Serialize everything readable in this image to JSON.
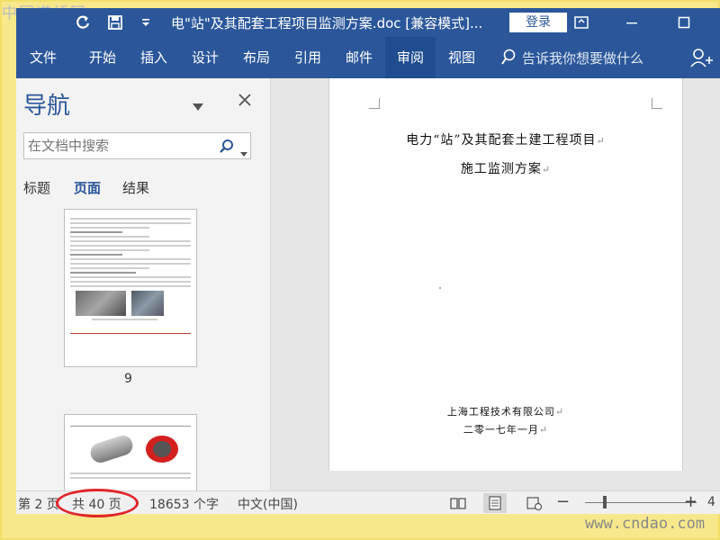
{
  "watermark": {
    "top_left": "中国道桥网",
    "bottom_right": "www.cndao.com"
  },
  "titlebar": {
    "title": "电\"站\"及其配套工程项目监测方案.doc [兼容模式]...",
    "login_label": "登录"
  },
  "ribbon": {
    "tabs": [
      "文件",
      "开始",
      "插入",
      "设计",
      "布局",
      "引用",
      "邮件",
      "审阅",
      "视图"
    ],
    "active_tab": "审阅",
    "tell_me_placeholder": "告诉我你想要做什么"
  },
  "navigation": {
    "title": "导航",
    "search_placeholder": "在文档中搜索",
    "tabs": [
      "标题",
      "页面",
      "结果"
    ],
    "active_tab": "页面",
    "thumbnail_page_number": "9"
  },
  "document": {
    "title_line1": "电力“站”及其配套土建工程项目",
    "title_line2": "施工监测方案",
    "company": "上海工程技术有限公司",
    "date": "二零一七年一月"
  },
  "statusbar": {
    "page_current": "第 2 页",
    "page_total": "共 40 页",
    "word_count": "18653 个字",
    "language": "中文(中国)",
    "zoom_end": "4"
  },
  "colors": {
    "ribbon": "#2b579a",
    "highlight_oval": "#e0262b",
    "frame": "#f2df6a"
  }
}
